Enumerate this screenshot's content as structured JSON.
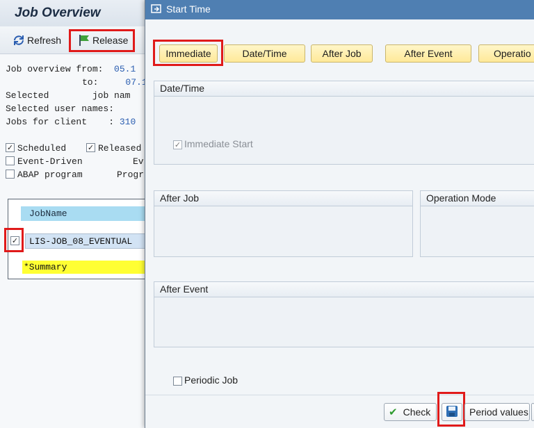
{
  "background": {
    "title": "Job Overview",
    "toolbar": {
      "refresh_label": "Refresh",
      "release_label": "Release"
    },
    "info": {
      "line1_label": "Job overview from:",
      "line1_value": "05.1",
      "line2_label": "to:",
      "line2_value": "07.1",
      "line3_label": "Selected",
      "line3_label2": "job nam",
      "line4_label": "Selected user names:",
      "line5_label": "Jobs for client",
      "line5_sep": ":",
      "line5_value": "310"
    },
    "filters": {
      "scheduled": "Scheduled",
      "released": "Released",
      "event_driven": "Event-Driven",
      "event_trunc": "Ev",
      "abap_program": "ABAP program",
      "program_trunc": "Progr"
    },
    "table": {
      "column_header": "JobName",
      "rows": [
        {
          "name": "LIS-JOB_08_EVENTUAL"
        }
      ],
      "summary": "*Summary"
    }
  },
  "dialog": {
    "title": "Start Time",
    "start_buttons": {
      "immediate": "Immediate",
      "date_time": "Date/Time",
      "after_job": "After Job",
      "after_event": "After Event",
      "operation": "Operatio"
    },
    "groups": {
      "date_time": "Date/Time",
      "immediate_start": "Immediate Start",
      "after_job": "After Job",
      "operation_mode": "Operation Mode",
      "after_event": "After Event"
    },
    "periodic_job": "Periodic Job",
    "footer": {
      "check": "Check",
      "period_values": "Period values"
    }
  },
  "colors": {
    "dialog_title_bg": "#4f7fb2",
    "highlight": "#e01a1a",
    "button_yellow": "#ffe999"
  }
}
